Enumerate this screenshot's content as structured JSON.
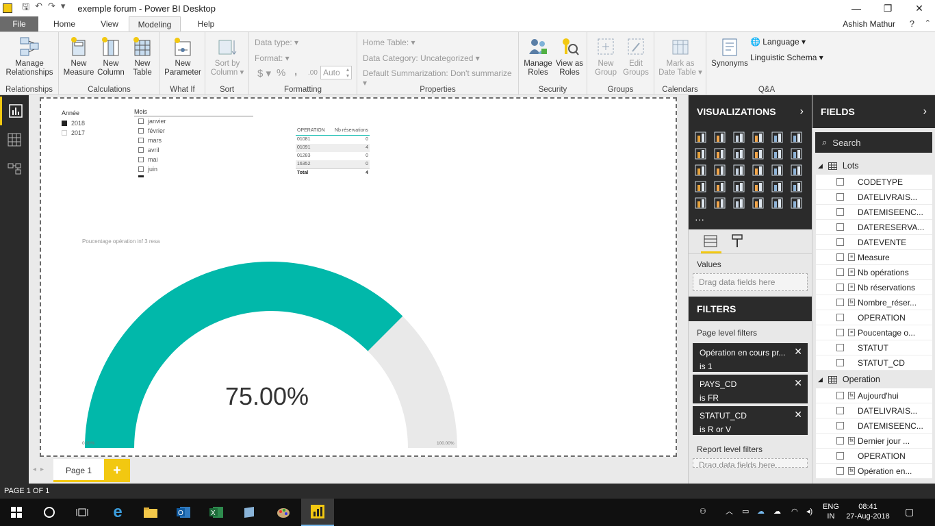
{
  "window": {
    "title": "exemple forum - Power BI Desktop",
    "user": "Ashish Mathur"
  },
  "tabs": {
    "file": "File",
    "home": "Home",
    "view": "View",
    "modeling": "Modeling",
    "help": "Help"
  },
  "ribbon": {
    "relationships": {
      "manage_l1": "Manage",
      "manage_l2": "Relationships",
      "group": "Relationships"
    },
    "calculations": {
      "nm_l1": "New",
      "nm_l2": "Measure",
      "nc_l1": "New",
      "nc_l2": "Column",
      "nt_l1": "New",
      "nt_l2": "Table",
      "group": "Calculations"
    },
    "whatif": {
      "np_l1": "New",
      "np_l2": "Parameter",
      "group": "What If"
    },
    "sort": {
      "sb_l1": "Sort by",
      "sb_l2": "Column",
      "group": "Sort"
    },
    "formatting": {
      "data_type": "Data type:",
      "format": "Format:",
      "currency": "$",
      "percent": "%",
      "comma": ",",
      "decimals": ".00",
      "auto": "Auto",
      "group": "Formatting"
    },
    "properties": {
      "home_table": "Home Table:",
      "data_category": "Data Category: Uncategorized",
      "default_summ": "Default Summarization: Don't summarize",
      "group": "Properties"
    },
    "security": {
      "mr_l1": "Manage",
      "mr_l2": "Roles",
      "va_l1": "View as",
      "va_l2": "Roles",
      "group": "Security"
    },
    "groups": {
      "ng_l1": "New",
      "ng_l2": "Group",
      "eg_l1": "Edit",
      "eg_l2": "Groups",
      "group": "Groups"
    },
    "calendars": {
      "md_l1": "Mark as",
      "md_l2": "Date Table",
      "group": "Calendars"
    },
    "qa": {
      "synonyms": "Synonyms",
      "language": "Language",
      "ling_schema": "Linguistic Schema",
      "group": "Q&A"
    }
  },
  "report": {
    "annee_slicer": {
      "title": "Année",
      "items": [
        {
          "label": "2018",
          "checked": true
        },
        {
          "label": "2017",
          "checked": false
        }
      ]
    },
    "mois_slicer": {
      "title": "Mois",
      "items": [
        "janvier",
        "février",
        "mars",
        "avril",
        "mai",
        "juin"
      ]
    },
    "matrix": {
      "headers": [
        "OPERATION",
        "Nb réservations"
      ],
      "rows": [
        [
          "01081",
          "0"
        ],
        [
          "01091",
          "4"
        ],
        [
          "01283",
          "0"
        ],
        [
          "16352",
          "0"
        ]
      ],
      "total": [
        "Total",
        "4"
      ]
    },
    "gauge": {
      "title": "Poucentage opération inf 3 resa",
      "value_label": "75.00%",
      "min_label": "0.00%",
      "max_label": "100.00%",
      "fill_color": "#01b8aa",
      "track_color": "#e9e9e9"
    }
  },
  "chart_data": {
    "type": "gauge",
    "title": "Poucentage opération inf 3 resa",
    "value": 75.0,
    "min": 0,
    "max": 100
  },
  "pages": {
    "page1": "Page 1",
    "add": "+"
  },
  "status": "PAGE 1 OF 1",
  "viz_pane": {
    "title": "VISUALIZATIONS",
    "values": "Values",
    "drag": "Drag data fields here"
  },
  "filters_pane": {
    "title": "FILTERS",
    "page_level": "Page level filters",
    "report_level": "Report level filters",
    "drag": "Drag data fields here",
    "cards": [
      {
        "name": "Opération en cours pr...",
        "cond": "is 1"
      },
      {
        "name": "PAYS_CD",
        "cond": "is FR"
      },
      {
        "name": "STATUT_CD",
        "cond": "is R or V"
      }
    ]
  },
  "fields_pane": {
    "title": "FIELDS",
    "search": "Search",
    "lots": {
      "name": "Lots",
      "fields": [
        "CODETYPE",
        "DATELIVRAIS...",
        "DATEMISEENC...",
        "DATERESERVA...",
        "DATEVENTE",
        "Measure",
        "Nb opérations",
        "Nb réservations",
        "Nombre_réser...",
        "OPERATION",
        "Poucentage o...",
        "STATUT",
        "STATUT_CD"
      ]
    },
    "operation": {
      "name": "Operation",
      "fields": [
        "Aujourd'hui",
        "DATELIVRAIS...",
        "DATEMISEENC...",
        "Dernier jour ...",
        "OPERATION",
        "Opération en..."
      ]
    }
  },
  "taskbar": {
    "lang1": "ENG",
    "lang2": "IN",
    "time": "08:41",
    "date": "27-Aug-2018"
  }
}
